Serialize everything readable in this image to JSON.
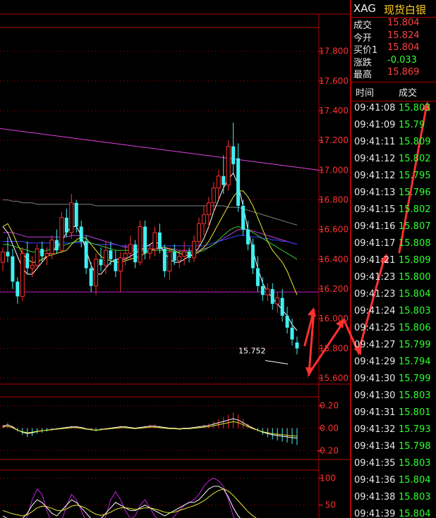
{
  "symbol": "XAG",
  "instrument_name": "现货白银",
  "quote": [
    {
      "label": "成交",
      "value": "15.804",
      "color": "#ff4040"
    },
    {
      "label": "今开",
      "value": "15.824",
      "color": "#ff4040"
    },
    {
      "label": "买价1",
      "value": "15.804",
      "color": "#ff4040"
    },
    {
      "label": "涨跌",
      "value": "-0.033",
      "color": "#3cff3c"
    },
    {
      "label": "最高",
      "value": "15.869",
      "color": "#ff4040"
    }
  ],
  "ticks_header": {
    "time": "时间",
    "price": "成交"
  },
  "ticks": [
    {
      "time": "09:41:08",
      "price": "15.803"
    },
    {
      "time": "09:41:09",
      "price": "15.79"
    },
    {
      "time": "09:41:11",
      "price": "15.809"
    },
    {
      "time": "09:41:12",
      "price": "15.802"
    },
    {
      "time": "09:41:12",
      "price": "15.795"
    },
    {
      "time": "09:41:13",
      "price": "15.796"
    },
    {
      "time": "09:41:15",
      "price": "15.802"
    },
    {
      "time": "09:41:16",
      "price": "15.807"
    },
    {
      "time": "09:41:17",
      "price": "15.808"
    },
    {
      "time": "09:41:21",
      "price": "15.809"
    },
    {
      "time": "09:41:23",
      "price": "15.800"
    },
    {
      "time": "09:41:23",
      "price": "15.804"
    },
    {
      "time": "09:41:24",
      "price": "15.803"
    },
    {
      "time": "09:41:25",
      "price": "15.806"
    },
    {
      "time": "09:41:27",
      "price": "15.799"
    },
    {
      "time": "09:41:29",
      "price": "15.794"
    },
    {
      "time": "09:41:30",
      "price": "15.799"
    },
    {
      "time": "09:41:30",
      "price": "15.803"
    },
    {
      "time": "09:41:31",
      "price": "15.801"
    },
    {
      "time": "09:41:32",
      "price": "15.793"
    },
    {
      "time": "09:41:34",
      "price": "15.798"
    },
    {
      "time": "09:41:35",
      "price": "15.803"
    },
    {
      "time": "09:41:36",
      "price": "15.804"
    },
    {
      "time": "09:41:38",
      "price": "15.803"
    },
    {
      "time": "09:41:39",
      "price": "15.804"
    }
  ],
  "colors": {
    "up": "#ff3030",
    "down": "#40f0f0",
    "flat": "#ff3030",
    "grid": "#b00000",
    "axis": "#ff3030",
    "tick_green": "#30ff30",
    "annot": "#ff3030"
  },
  "chart_data": [
    {
      "type": "candlestick",
      "title": "",
      "y_ticks": [
        "17.800",
        "17.600",
        "17.400",
        "17.200",
        "17.000",
        "16.800",
        "16.600",
        "16.400",
        "16.200",
        "16.000",
        "15.800",
        "15.600"
      ],
      "ylim": [
        15.56,
        17.96
      ],
      "grid": true,
      "low_annotation": "15.752",
      "candles": [
        [
          16.38,
          16.48,
          16.32,
          16.45
        ],
        [
          16.45,
          16.55,
          16.38,
          16.42
        ],
        [
          16.42,
          16.47,
          16.2,
          16.25
        ],
        [
          16.25,
          16.28,
          16.1,
          16.15
        ],
        [
          16.15,
          16.48,
          16.12,
          16.44
        ],
        [
          16.44,
          16.52,
          16.3,
          16.34
        ],
        [
          16.34,
          16.42,
          16.28,
          16.36
        ],
        [
          16.36,
          16.5,
          16.33,
          16.47
        ],
        [
          16.47,
          16.52,
          16.38,
          16.42
        ],
        [
          16.42,
          16.48,
          16.36,
          16.44
        ],
        [
          16.44,
          16.56,
          16.4,
          16.53
        ],
        [
          16.53,
          16.6,
          16.44,
          16.46
        ],
        [
          16.46,
          16.72,
          16.44,
          16.68
        ],
        [
          16.68,
          16.74,
          16.55,
          16.58
        ],
        [
          16.58,
          16.84,
          16.54,
          16.78
        ],
        [
          16.78,
          16.8,
          16.58,
          16.62
        ],
        [
          16.62,
          16.66,
          16.48,
          16.52
        ],
        [
          16.52,
          16.56,
          16.3,
          16.34
        ],
        [
          16.34,
          16.38,
          16.18,
          16.22
        ],
        [
          16.22,
          16.44,
          16.16,
          16.4
        ],
        [
          16.4,
          16.48,
          16.32,
          16.36
        ],
        [
          16.36,
          16.52,
          16.3,
          16.46
        ],
        [
          16.46,
          16.52,
          16.36,
          16.4
        ],
        [
          16.4,
          16.46,
          16.28,
          16.32
        ],
        [
          16.32,
          16.45,
          16.18,
          16.41
        ],
        [
          16.41,
          16.5,
          16.36,
          16.44
        ],
        [
          16.44,
          16.56,
          16.4,
          16.5
        ],
        [
          16.5,
          16.53,
          16.34,
          16.38
        ],
        [
          16.38,
          16.66,
          16.36,
          16.62
        ],
        [
          16.62,
          16.66,
          16.4,
          16.44
        ],
        [
          16.44,
          16.5,
          16.4,
          16.47
        ],
        [
          16.47,
          16.62,
          16.42,
          16.58
        ],
        [
          16.58,
          16.64,
          16.44,
          16.47
        ],
        [
          16.47,
          16.5,
          16.28,
          16.32
        ],
        [
          16.32,
          16.48,
          16.26,
          16.45
        ],
        [
          16.45,
          16.5,
          16.36,
          16.39
        ],
        [
          16.39,
          16.46,
          16.34,
          16.42
        ],
        [
          16.42,
          16.52,
          16.36,
          16.45
        ],
        [
          16.45,
          16.48,
          16.38,
          16.41
        ],
        [
          16.41,
          16.56,
          16.38,
          16.52
        ],
        [
          16.52,
          16.68,
          16.48,
          16.64
        ],
        [
          16.64,
          16.76,
          16.56,
          16.7
        ],
        [
          16.7,
          16.82,
          16.62,
          16.78
        ],
        [
          16.78,
          16.92,
          16.72,
          16.88
        ],
        [
          16.88,
          17.0,
          16.8,
          16.96
        ],
        [
          16.96,
          17.1,
          16.84,
          16.9
        ],
        [
          16.9,
          17.2,
          16.86,
          17.16
        ],
        [
          17.16,
          17.32,
          16.98,
          17.04
        ],
        [
          17.08,
          17.18,
          16.72,
          16.76
        ],
        [
          16.76,
          16.8,
          16.56,
          16.6
        ],
        [
          16.6,
          16.66,
          16.46,
          16.5
        ],
        [
          16.5,
          16.54,
          16.3,
          16.34
        ],
        [
          16.34,
          16.42,
          16.18,
          16.22
        ],
        [
          16.22,
          16.28,
          16.12,
          16.16
        ],
        [
          16.16,
          16.24,
          16.12,
          16.2
        ],
        [
          16.2,
          16.24,
          16.06,
          16.1
        ],
        [
          16.1,
          16.18,
          16.04,
          16.14
        ],
        [
          16.14,
          16.2,
          15.98,
          16.02
        ],
        [
          16.02,
          16.08,
          15.9,
          15.94
        ],
        [
          15.94,
          16.0,
          15.82,
          15.86
        ],
        [
          15.84,
          15.88,
          15.76,
          15.8
        ]
      ],
      "lines": {
        "ma_yellow": [
          16.62,
          16.64,
          16.58,
          16.5,
          16.44,
          16.4,
          16.38,
          16.38,
          16.4,
          16.42,
          16.43,
          16.44,
          16.45,
          16.46,
          16.5,
          16.53,
          16.55,
          16.54,
          16.5,
          16.46,
          16.42,
          16.4,
          16.39,
          16.38,
          16.38,
          16.39,
          16.4,
          16.41,
          16.42,
          16.44,
          16.46,
          16.47,
          16.48,
          16.48,
          16.47,
          16.46,
          16.44,
          16.43,
          16.42,
          16.43,
          16.45,
          16.48,
          16.52,
          16.58,
          16.64,
          16.7,
          16.76,
          16.82,
          16.86,
          16.86,
          16.82,
          16.76,
          16.68,
          16.6,
          16.52,
          16.46,
          16.42,
          16.38,
          16.32,
          16.24,
          16.16
        ],
        "ma_white": [
          16.62,
          16.58,
          16.5,
          16.42,
          16.34,
          16.3,
          16.3,
          16.34,
          16.38,
          16.42,
          16.45,
          16.48,
          16.52,
          16.58,
          16.62,
          16.62,
          16.56,
          16.46,
          16.36,
          16.3,
          16.3,
          16.34,
          16.38,
          16.4,
          16.4,
          16.4,
          16.42,
          16.44,
          16.46,
          16.48,
          16.5,
          16.52,
          16.5,
          16.44,
          16.4,
          16.38,
          16.38,
          16.4,
          16.42,
          16.44,
          16.48,
          16.54,
          16.62,
          16.72,
          16.8,
          16.88,
          16.94,
          16.98,
          16.9,
          16.76,
          16.6,
          16.46,
          16.34,
          16.24,
          16.18,
          16.14,
          16.1,
          16.06,
          16.02,
          15.96,
          15.92
        ],
        "ma_green": [
          16.5,
          16.5,
          16.49,
          16.48,
          16.47,
          16.46,
          16.45,
          16.45,
          16.45,
          16.46,
          16.47,
          16.48,
          16.49,
          16.5,
          16.51,
          16.52,
          16.52,
          16.52,
          16.51,
          16.5,
          16.49,
          16.48,
          16.47,
          16.46,
          16.46,
          16.46,
          16.46,
          16.46,
          16.46,
          16.46,
          16.46,
          16.46,
          16.46,
          16.46,
          16.46,
          16.45,
          16.45,
          16.45,
          16.45,
          16.45,
          16.45,
          16.46,
          16.48,
          16.5,
          16.53,
          16.56,
          16.59,
          16.61,
          16.62,
          16.61,
          16.6,
          16.58,
          16.56,
          16.54,
          16.52,
          16.5,
          16.48,
          16.46,
          16.44,
          16.42,
          16.4
        ],
        "ma_magenta": [
          16.58,
          16.58,
          16.58,
          16.57,
          16.56,
          16.55,
          16.55,
          16.55,
          16.55,
          16.55,
          16.55,
          16.55,
          16.55,
          16.55,
          16.56,
          16.56,
          16.56,
          16.56,
          16.55,
          16.54,
          16.53,
          16.52,
          16.51,
          16.5,
          16.49,
          16.48,
          16.48,
          16.47,
          16.47,
          16.47,
          16.47,
          16.47,
          16.47,
          16.47,
          16.47,
          16.47,
          16.46,
          16.46,
          16.46,
          16.46,
          16.46,
          16.47,
          16.48,
          16.5,
          16.52,
          16.54,
          16.56,
          16.58,
          16.6,
          16.6,
          16.6,
          16.59,
          16.58,
          16.57,
          16.56,
          16.55,
          16.54,
          16.53,
          16.52,
          16.51,
          16.5
        ],
        "ma_blue": [
          16.52,
          16.52,
          16.52,
          16.52,
          16.52,
          16.51,
          16.51,
          16.51,
          16.51,
          16.51,
          16.51,
          16.51,
          16.51,
          16.51,
          16.51,
          16.51,
          16.51,
          16.51,
          16.51,
          16.5,
          16.5,
          16.5,
          16.5,
          16.5,
          16.49,
          16.49,
          16.49,
          16.49,
          16.49,
          16.49,
          16.49,
          16.49,
          16.49,
          16.49,
          16.49,
          16.49,
          16.49,
          16.49,
          16.49,
          16.49,
          16.49,
          16.49,
          16.5,
          16.51,
          16.52,
          16.53,
          16.54,
          16.55,
          16.56,
          16.56,
          16.56,
          16.55,
          16.55,
          16.54,
          16.54,
          16.53,
          16.53,
          16.52,
          16.52,
          16.51,
          16.5
        ],
        "ma_gray": [
          16.8,
          16.8,
          16.79,
          16.79,
          16.78,
          16.78,
          16.78,
          16.77,
          16.77,
          16.77,
          16.77,
          16.77,
          16.77,
          16.77,
          16.77,
          16.77,
          16.77,
          16.77,
          16.77,
          16.76,
          16.76,
          16.76,
          16.76,
          16.76,
          16.76,
          16.76,
          16.76,
          16.76,
          16.76,
          16.76,
          16.76,
          16.76,
          16.76,
          16.76,
          16.76,
          16.76,
          16.76,
          16.76,
          16.76,
          16.76,
          16.76,
          16.76,
          16.76,
          16.76,
          16.76,
          16.76,
          16.75,
          16.75,
          16.75,
          16.74,
          16.73,
          16.72,
          16.71,
          16.7,
          16.69,
          16.68,
          16.67,
          16.66,
          16.65,
          16.64,
          16.63
        ],
        "trend_magenta": [
          17.28,
          17.0
        ],
        "hline_purple": 16.18
      }
    },
    {
      "type": "macd_histogram",
      "y_ticks": [
        "0.20",
        "0.00",
        "-0.20"
      ],
      "ylim": [
        -0.28,
        0.28
      ],
      "bars": [
        0.03,
        0.05,
        0.02,
        -0.03,
        -0.06,
        -0.08,
        -0.07,
        -0.05,
        -0.04,
        -0.03,
        -0.02,
        -0.01,
        0.0,
        0.01,
        0.02,
        0.02,
        0.01,
        -0.01,
        -0.02,
        -0.03,
        -0.02,
        -0.01,
        0.0,
        0.01,
        0.02,
        0.02,
        0.01,
        0.0,
        0.01,
        0.02,
        0.03,
        0.03,
        0.02,
        0.01,
        0.0,
        0.0,
        -0.01,
        0.0,
        0.0,
        0.01,
        0.02,
        0.03,
        0.04,
        0.06,
        0.08,
        0.1,
        0.12,
        0.14,
        0.12,
        0.08,
        0.04,
        0.0,
        -0.03,
        -0.06,
        -0.08,
        -0.1,
        -0.11,
        -0.12,
        -0.13,
        -0.14,
        -0.15
      ]
    },
    {
      "type": "kdj",
      "y_ticks": [
        "100",
        "50"
      ],
      "ylim": [
        0,
        115
      ],
      "j": [
        10,
        5,
        0,
        0,
        10,
        30,
        60,
        80,
        70,
        40,
        15,
        5,
        20,
        50,
        70,
        60,
        40,
        20,
        5,
        0,
        10,
        30,
        60,
        75,
        60,
        40,
        25,
        30,
        50,
        60,
        45,
        30,
        20,
        15,
        20,
        30,
        40,
        50,
        55,
        60,
        70,
        85,
        95,
        100,
        95,
        85,
        60,
        30,
        10,
        0,
        0,
        0,
        5,
        5,
        10,
        10,
        15,
        10,
        10,
        5,
        5
      ],
      "k": [
        30,
        25,
        20,
        20,
        25,
        35,
        50,
        60,
        55,
        45,
        35,
        30,
        40,
        50,
        60,
        55,
        45,
        35,
        25,
        20,
        25,
        35,
        45,
        55,
        50,
        45,
        40,
        40,
        45,
        50,
        45,
        40,
        35,
        30,
        35,
        40,
        45,
        50,
        55,
        55,
        60,
        70,
        80,
        85,
        85,
        80,
        65,
        45,
        30,
        20,
        15,
        12,
        10,
        10,
        12,
        14,
        15,
        14,
        12,
        10,
        10
      ],
      "d": [
        40,
        37,
        34,
        32,
        30,
        32,
        38,
        45,
        48,
        47,
        44,
        40,
        40,
        43,
        48,
        50,
        48,
        44,
        38,
        33,
        31,
        33,
        37,
        42,
        45,
        45,
        44,
        42,
        43,
        45,
        45,
        43,
        40,
        37,
        36,
        37,
        40,
        43,
        46,
        49,
        53,
        58,
        65,
        72,
        77,
        80,
        76,
        68,
        58,
        48,
        38,
        30,
        24,
        19,
        16,
        14,
        14,
        14,
        13,
        12,
        11
      ]
    }
  ]
}
